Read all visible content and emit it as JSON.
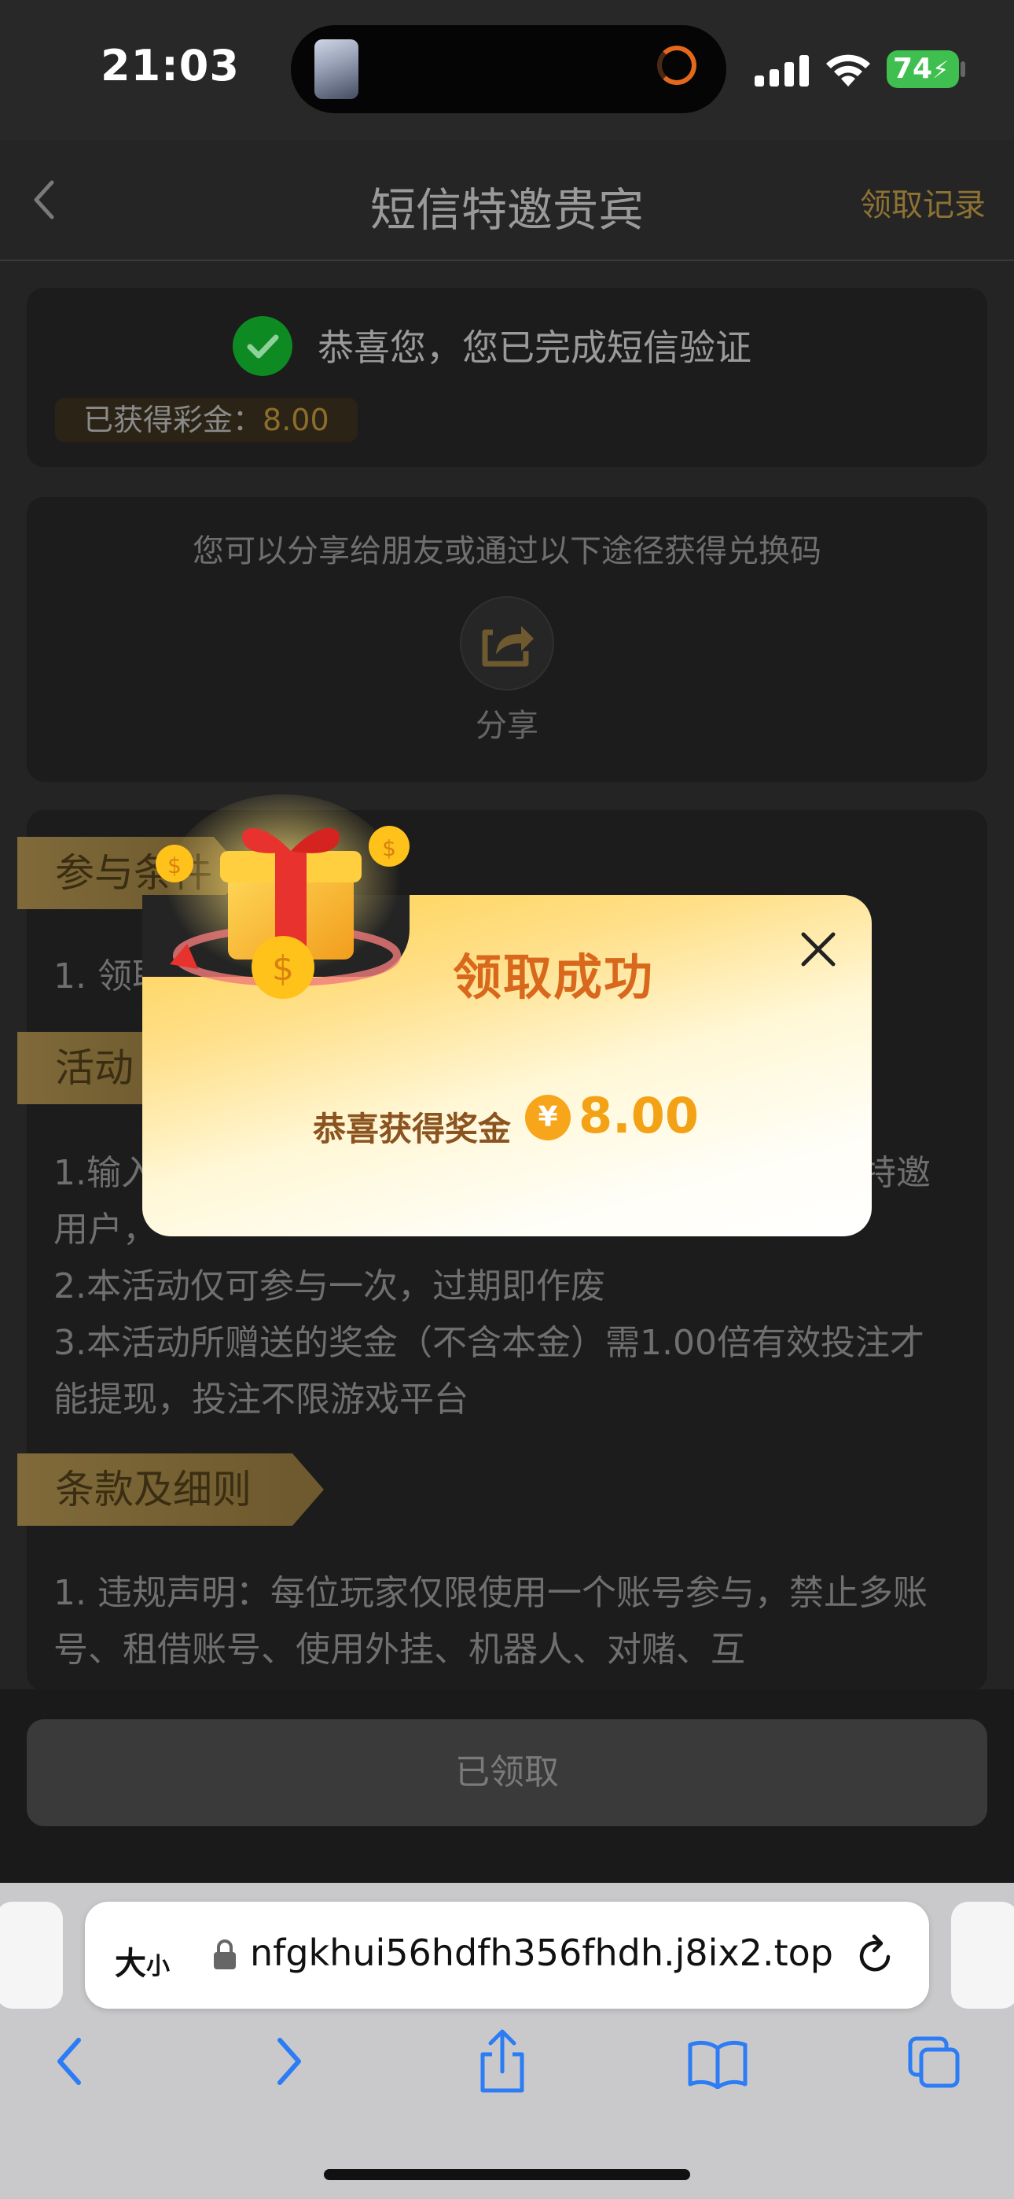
{
  "status_bar": {
    "time": "21:03",
    "battery": "74"
  },
  "nav": {
    "title": "短信特邀贵宾",
    "right_link": "领取记录"
  },
  "verification": {
    "message": "恭喜您，您已完成短信验证",
    "bonus_label": "已获得彩金：",
    "bonus_value": "8.00"
  },
  "share": {
    "hint": "您可以分享给朋友或通过以下途径获得兑换码",
    "label": "分享"
  },
  "sections": {
    "participate_title": "参与条件",
    "participate_line1": "1. 领取",
    "activity_title": "活动",
    "activity_line1": "1.输入",
    "activity_line1_end": "特邀",
    "activity_line1b": "用户，",
    "activity_line2": "2.本活动仅可参与一次，过期即作废",
    "activity_line3": "3.本活动所赠送的奖金（不含本金）需1.00倍有效投注才能提现，投注不限游戏平台",
    "terms_title": "条款及细则",
    "terms_line1": "1. 违规声明：每位玩家仅限使用一个账号参与，禁止多账号、租借账号、使用外挂、机器人、对赌、互"
  },
  "bottom_button": "已领取",
  "popup": {
    "title": "领取成功",
    "message": "恭喜获得奖金",
    "currency_symbol": "¥",
    "amount": "8.00"
  },
  "safari": {
    "size_label": "大",
    "size_label_small": "小",
    "url": "nfgkhui56hdfh356fhdh.j8ix2.top"
  }
}
